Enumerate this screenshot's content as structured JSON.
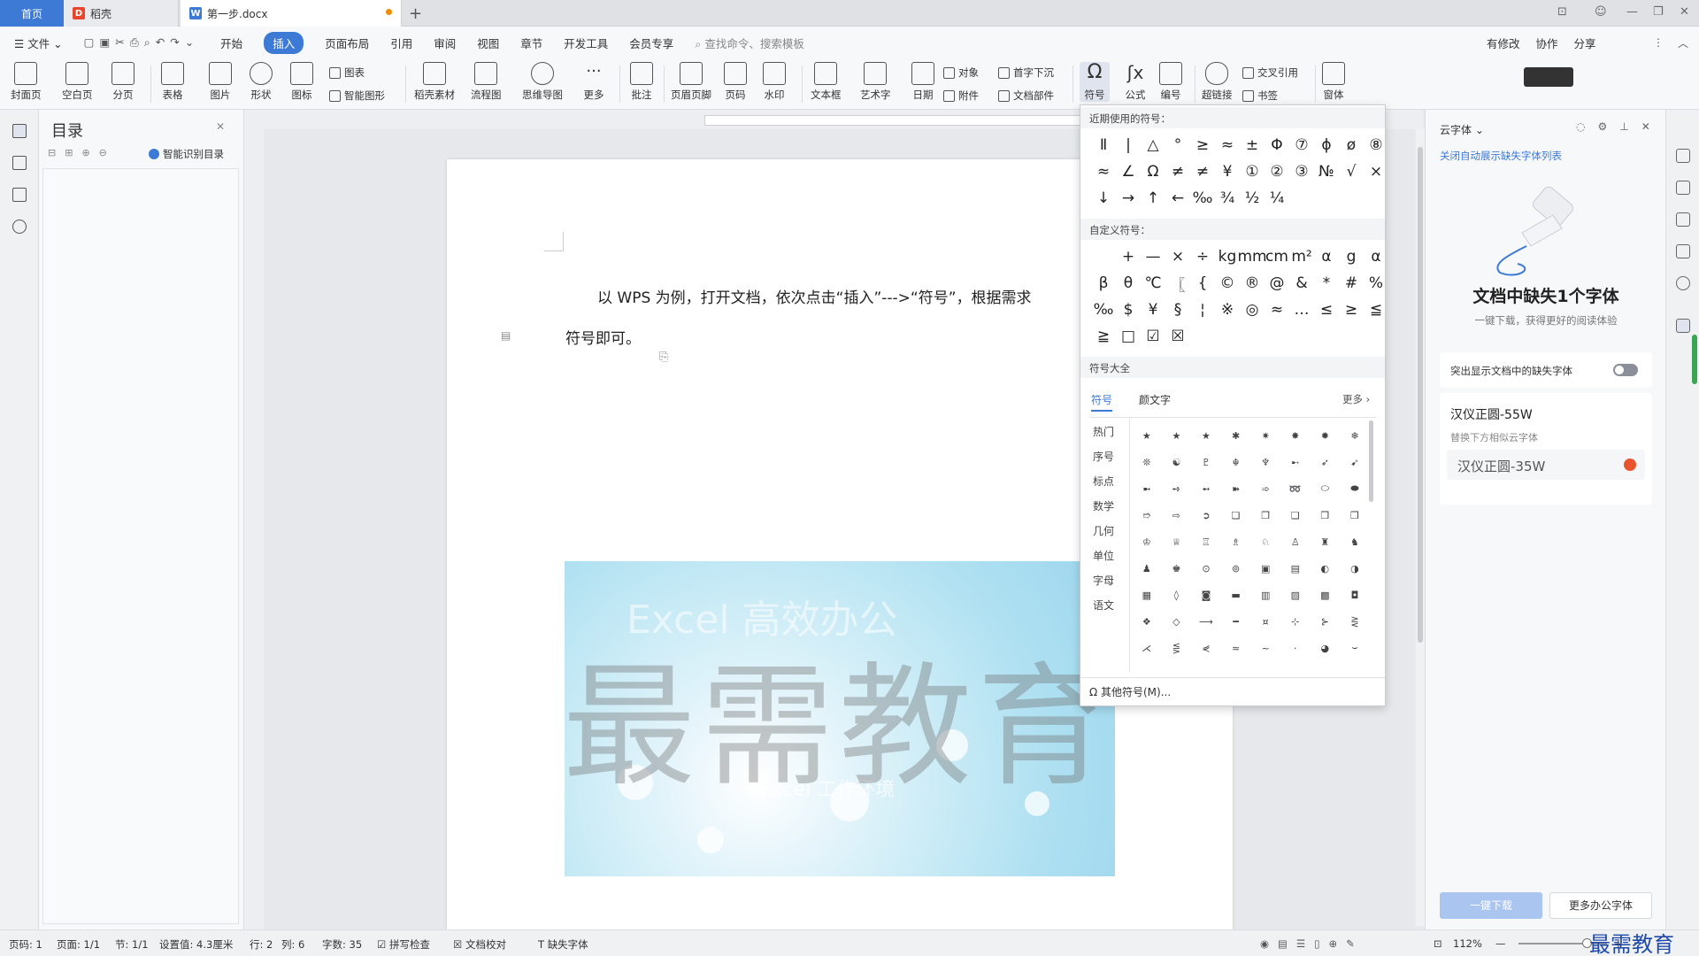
{
  "titlebar": {
    "tabs": [
      {
        "label": "首页"
      },
      {
        "label": "稻壳"
      },
      {
        "label": "第一步.docx"
      }
    ],
    "add_tab": "+"
  },
  "menubar": {
    "file": "文件",
    "items": [
      "开始",
      "插入",
      "页面布局",
      "引用",
      "审阅",
      "视图",
      "章节",
      "开发工具",
      "会员专享"
    ],
    "active": "插入",
    "search_placeholder": "查找命令、搜索模板",
    "right": [
      "有修改",
      "协作",
      "分享"
    ]
  },
  "toolbar": {
    "large": [
      "封面页",
      "空白页",
      "分页",
      "表格",
      "图片",
      "形状",
      "图标",
      "稻壳素材",
      "流程图",
      "思维导图",
      "更多",
      "批注",
      "页眉页脚",
      "页码",
      "水印",
      "文本框",
      "艺术字",
      "日期",
      "编号",
      "超链接",
      "符号",
      "公式",
      "窗体"
    ],
    "small": [
      "图表",
      "智能图形",
      "对象",
      "附件",
      "首字下沉",
      "文档部件",
      "交叉引用",
      "书签"
    ]
  },
  "toc": {
    "title": "目录",
    "smart_btn": "智能识别目录"
  },
  "document": {
    "line1": "以 WPS 为例，打开文档，依次点击“插入”--->“符号”，根据需求",
    "line2": "符号即可。",
    "watermark_big": "最需教育",
    "watermark_small_top": "Excel 高效办公",
    "watermark_small_bottom": "Excel 工作环境"
  },
  "symbol_panel": {
    "recent_title": "近期使用的符号：",
    "recent": [
      "Ⅱ",
      "|",
      "△",
      "°",
      "≥",
      "≈",
      "±",
      "Φ",
      "⑦",
      "ϕ",
      "ø",
      "⑧",
      "≈",
      "∠",
      "Ω",
      "≠",
      "≠",
      "¥",
      "①",
      "②",
      "③",
      "№",
      "√",
      "×",
      "↓",
      "→",
      "↑",
      "←",
      "‰",
      "¾",
      "½",
      "¼"
    ],
    "custom_title": "自定义符号：",
    "custom": [
      "",
      "+",
      "—",
      "×",
      "÷",
      "kg",
      "mm",
      "cm",
      "m²",
      "α",
      "g",
      "α",
      "β",
      "θ",
      "℃",
      "〖",
      "{",
      "©",
      "®",
      "@",
      "&",
      "*",
      "#",
      "%",
      "‰",
      "$",
      "¥",
      "§",
      "¦",
      "※",
      "◎",
      "≈",
      "…",
      "≤",
      "≥",
      "≦",
      "≧",
      "□",
      "☑",
      "☒"
    ],
    "all_title": "符号大全",
    "tabs": [
      "符号",
      "颜文字"
    ],
    "more": "更多",
    "categories": [
      "热门",
      "序号",
      "标点",
      "数学",
      "几何",
      "单位",
      "字母",
      "语文"
    ],
    "all_symbols": [
      "★",
      "★",
      "★",
      "✱",
      "✷",
      "✸",
      "✹",
      "❄",
      "❊",
      "☯",
      "♇",
      "☬",
      "♆",
      "➸",
      "➶",
      "➹",
      "➼",
      "➺",
      "➻",
      "➽",
      "➾",
      "➿",
      "⬭",
      "⬬",
      "➱",
      "⇨",
      "➲",
      "❏",
      "❐",
      "❑",
      "❒",
      "❒",
      "♔",
      "♕",
      "♖",
      "♗",
      "♘",
      "♙",
      "♜",
      "♞",
      "♟",
      "♚",
      "⊙",
      "⊚",
      "▣",
      "▤",
      "◐",
      "◑",
      "▦",
      "◊",
      "◙",
      "▬",
      "▥",
      "▨",
      "▩",
      "◘",
      "❖",
      "◇",
      "⟶",
      "━",
      "¤",
      "⊹",
      "⊱",
      "⋛",
      "⋌",
      "⋚",
      "⋞",
      "≈",
      "~",
      "·",
      "◕",
      "⌣"
    ],
    "other": "其他符号(M)..."
  },
  "rightpanel": {
    "title": "云字体",
    "close_link": "关闭自动展示缺失字体列表",
    "headline": "文档中缺失1个字体",
    "sub": "一键下载，获得更好的阅读体验",
    "toggle_label": "突出显示文档中的缺失字体",
    "font_name": "汉仪正圆-55W",
    "replace_hint": "替换下方相似云字体",
    "replacement": "汉仪正圆-35W",
    "download_btn": "一键下载",
    "more_btn": "更多办公字体"
  },
  "statusbar": {
    "items": [
      "页码: 1",
      "页面: 1/1",
      "节: 1/1",
      "设置值: 4.3厘米",
      "行: 2",
      "列: 6",
      "字数: 35",
      "拼写检查",
      "文档校对",
      "缺失字体"
    ],
    "zoom": "112%",
    "brand": "最需教育"
  },
  "colors": {
    "accent": "#3c7ad6",
    "toolbar_bg": "#f7f8fa",
    "page_bg": "#ffffff"
  }
}
